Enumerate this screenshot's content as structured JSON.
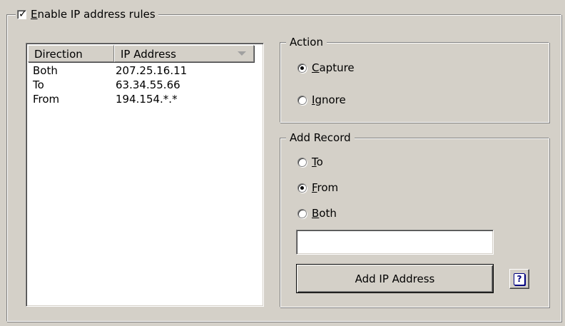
{
  "enable_rules": {
    "checked": true,
    "label_accel": "E",
    "label_rest": "nable IP address rules"
  },
  "list": {
    "columns": [
      "Direction",
      "IP Address"
    ],
    "rows": [
      {
        "direction": "Both",
        "ip": "207.25.16.11"
      },
      {
        "direction": "To",
        "ip": "63.34.55.66"
      },
      {
        "direction": "From",
        "ip": "194.154.*.*"
      }
    ]
  },
  "action": {
    "title": "Action",
    "capture": {
      "accel": "C",
      "rest": "apture",
      "selected": true
    },
    "ignore": {
      "accel": "I",
      "rest": "gnore",
      "selected": false
    }
  },
  "add_record": {
    "title": "Add Record",
    "to": {
      "accel": "T",
      "rest": "o",
      "selected": false
    },
    "from": {
      "accel": "F",
      "rest": "rom",
      "selected": true
    },
    "both": {
      "accel": "B",
      "rest": "oth",
      "selected": false
    },
    "ip_value": "",
    "button_label": "Add IP Address",
    "help_glyph": "?"
  }
}
